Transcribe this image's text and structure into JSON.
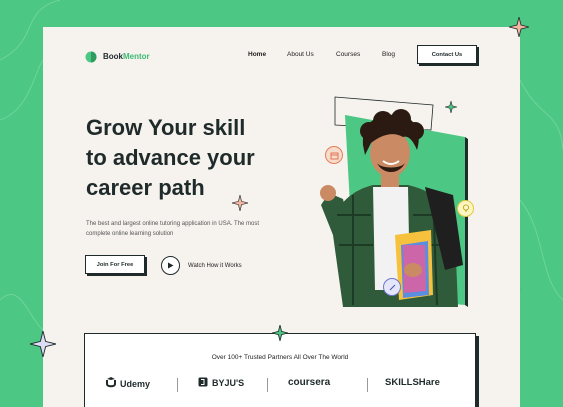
{
  "brand": {
    "name_part1": "Book",
    "name_part2": "Mentor"
  },
  "nav": {
    "items": [
      {
        "label": "Home"
      },
      {
        "label": "About Us"
      },
      {
        "label": "Courses"
      },
      {
        "label": "Blog"
      }
    ],
    "cta_label": "Contact Us"
  },
  "hero": {
    "line1_a": "Grow Your ",
    "line1_b": "skill",
    "line2": "to advance your",
    "line3_a": "career",
    "line3_b": " path",
    "description": "The best and largest online tutoring application in USA. The most complete online learning solution",
    "join_label": "Join For Free",
    "watch_label": "Watch How it Works"
  },
  "partners": {
    "title": "Over 100+ Trusted Partners All Over The World",
    "logos": [
      {
        "name": "Udemy",
        "icon": "udemy-logo"
      },
      {
        "name": "BYJU'S",
        "icon": "byjus-logo"
      },
      {
        "name": "coursera",
        "icon": "coursera-logo"
      },
      {
        "name": "SKILLSHare",
        "icon": "skillshare-logo"
      }
    ]
  },
  "colors": {
    "accent": "#4cc784",
    "dark": "#1f2a2a",
    "page_bg": "#f6f3ee"
  },
  "icons": [
    "sparkle-icon",
    "play-icon",
    "calendar-icon",
    "bulb-icon",
    "pencil-icon"
  ]
}
